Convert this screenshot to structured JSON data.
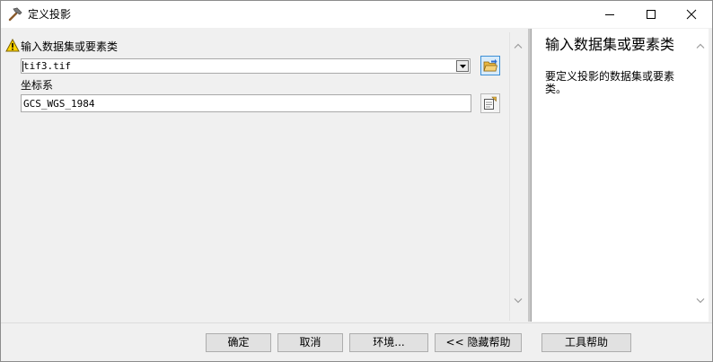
{
  "window": {
    "title": "定义投影",
    "icon": "hammer-icon"
  },
  "params": {
    "input_label": "输入数据集或要素类",
    "input_value": "tif3.tif",
    "crs_label": "坐标系",
    "crs_value": "GCS_WGS_1984"
  },
  "help": {
    "title": "输入数据集或要素类",
    "text": "要定义投影的数据集或要素类。"
  },
  "buttons": {
    "ok": "确定",
    "cancel": "取消",
    "environments": "环境...",
    "hide_help": "<< 隐藏帮助",
    "tool_help": "工具帮助"
  },
  "colors": {
    "warning": "#ffd400",
    "active_button_border": "#3c8fd6",
    "folder": "#e8b640"
  }
}
